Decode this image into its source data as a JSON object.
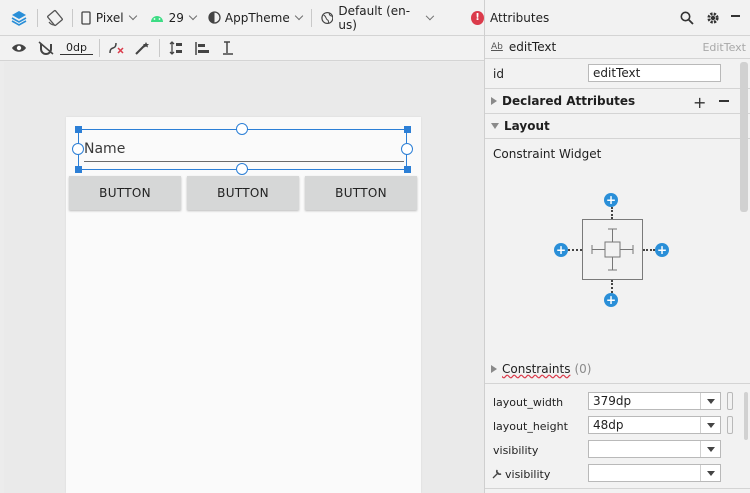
{
  "toolbar": {
    "device": "Pixel",
    "api_level": "29",
    "theme": "AppTheme",
    "locale": "Default (en-us)",
    "margin": "0dp"
  },
  "design": {
    "edit_text_hint": "Name",
    "buttons": [
      {
        "label": "BUTTON"
      },
      {
        "label": "BUTTON"
      },
      {
        "label": "BUTTON"
      }
    ]
  },
  "attributes": {
    "title": "Attributes",
    "component": {
      "prefix": "Ab",
      "name": "editText",
      "type": "EditText"
    },
    "id": {
      "label": "id",
      "value": "editText"
    },
    "declared_attributes": "Declared Attributes",
    "layout": "Layout",
    "constraint_widget": "Constraint Widget",
    "constraints": {
      "label": "Constraints",
      "count": "(0)"
    },
    "layout_width": {
      "label": "layout_width",
      "value": "379dp"
    },
    "layout_height": {
      "label": "layout_height",
      "value": "48dp"
    },
    "visibility": {
      "label": "visibility",
      "value": ""
    },
    "tools_visibility": {
      "label": "visibility",
      "value": ""
    }
  },
  "icons": {
    "layers": "layers-icon",
    "orientation": "orientation-icon",
    "error": "error-icon",
    "search": "search-icon",
    "settings": "gear-icon"
  },
  "colors": {
    "accent": "#2c7fd6",
    "error": "#db3b4b",
    "android": "#3ddc84"
  }
}
